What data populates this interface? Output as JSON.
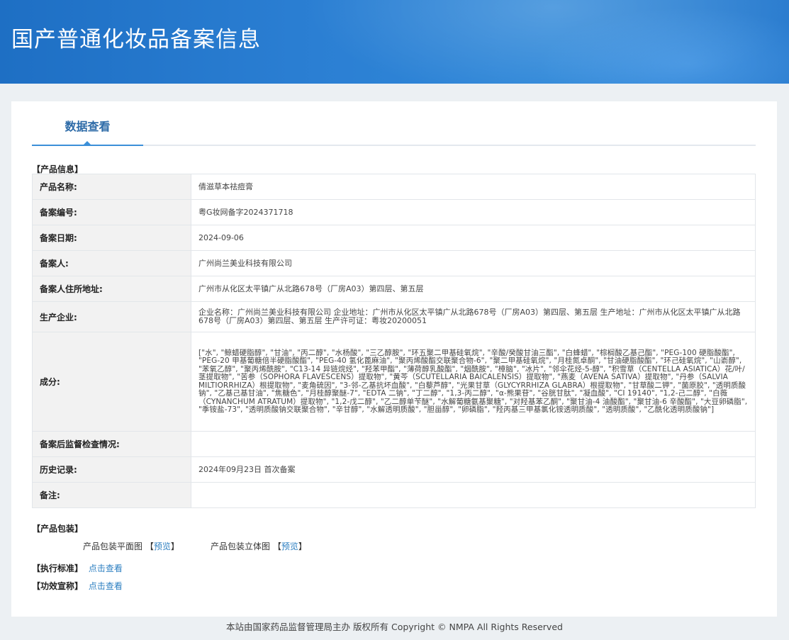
{
  "header": {
    "title": "国产普通化妆品备案信息"
  },
  "tabs": [
    {
      "label": "数据查看"
    }
  ],
  "product_info": {
    "section_title": "【产品信息】",
    "rows": [
      {
        "label": "产品名称:",
        "value": "倩滋草本祛痘膏"
      },
      {
        "label": "备案编号:",
        "value": "粤G妆网备字2024371718"
      },
      {
        "label": "备案日期:",
        "value": "2024-09-06"
      },
      {
        "label": "备案人:",
        "value": "广州尚兰美业科技有限公司"
      },
      {
        "label": "备案人住所地址:",
        "value": "广州市从化区太平镇广从北路678号（厂房A03）第四层、第五层"
      },
      {
        "label": "生产企业:",
        "value": "企业名称：广州尚兰美业科技有限公司 企业地址：广州市从化区太平镇广从北路678号（厂房A03）第四层、第五层 生产地址：广州市从化区太平镇广从北路678号（厂房A03）第四层、第五层 生产许可证：粤妆20200051"
      },
      {
        "label": "成分:",
        "value": "[\"水\", \"鲸蜡硬脂醇\", \"甘油\", \"丙二醇\", \"水杨酸\", \"三乙醇胺\", \"环五聚二甲基硅氧烷\", \"辛酸/癸酸甘油三酯\", \"白蜂蜡\", \"棕榈酸乙基己酯\", \"PEG-100 硬脂酸酯\", \"PEG-20 甲基葡糖倍半硬脂酸酯\", \"PEG-40 氢化蓖麻油\", \"聚丙烯酸酯交联聚合物-6\", \"聚二甲基硅氧烷\", \"月桂氮卓酮\", \"甘油硬脂酸酯\", \"环己硅氧烷\", \"山嵛醇\", \"苯氧乙醇\", \"聚丙烯酰胺\", \"C13-14 异链烷烃\", \"羟苯甲酯\", \"薄荷醇乳酸酯\", \"烟酰胺\", \"樟脑\", \"冰片\", \"邻伞花烃-5-醇\", \"积雪草（CENTELLA ASIATICA）花/叶/茎提取物\", \"苦参（SOPHORA FLAVESCENS）提取物\", \"黄芩（SCUTELLARIA BAICALENSIS）提取物\", \"燕麦（AVENA SATIVA）提取物\", \"丹参（SALVIA MILTIORRHIZA）根提取物\", \"麦角硫因\", \"3-邻-乙基抗坏血酸\", \"白藜芦醇\", \"光果甘草（GLYCYRRHIZA GLABRA）根提取物\", \"甘草酸二钾\", \"菌原胶\", \"透明质酸钠\", \"乙基己基甘油\", \"焦糖色\", \"月桂醇聚醚-7\", \"EDTA 二钠\", \"丁二醇\", \"1,3-丙二醇\", \"α-熊果苷\", \"谷胱甘肽\", \"凝血酸\", \"CI 19140\", \"1,2-己二醇\", \"白薇（CYNANCHUM ATRATUM）提取物\", \"1,2-戊二醇\", \"乙二醇单苄醚\", \"水解葡糖氨基聚糖\", \"对羟基苯乙酮\", \"聚甘油-4 油酸酯\", \"聚甘油-6 辛酸酯\", \"大豆卵磷脂\", \"季铵盐-73\", \"透明质酸钠交联聚合物\", \"辛甘醇\", \"水解透明质酸\", \"胆甾醇\", \"卵磷脂\", \"羟丙基三甲基氯化铵透明质酸\", \"透明质酸\", \"乙酰化透明质酸钠\"]"
      },
      {
        "label": "备案后监督检查情况:",
        "value": ""
      },
      {
        "label": "历史记录:",
        "value": "2024年09月23日 首次备案"
      },
      {
        "label": "备注:",
        "value": ""
      }
    ]
  },
  "packaging": {
    "section_title": "【产品包装】",
    "flat_label": "产品包装平面图",
    "solid_label": "产品包装立体图",
    "preview_open": "【",
    "preview_link": "预览",
    "preview_close": "】"
  },
  "standard": {
    "label": "【执行标准】",
    "link": "点击查看"
  },
  "efficacy": {
    "label": "【功效宣称】",
    "link": "点击查看"
  },
  "footer": {
    "text": "本站由国家药品监督管理局主办 版权所有 Copyright © NMPA All Rights Reserved"
  }
}
